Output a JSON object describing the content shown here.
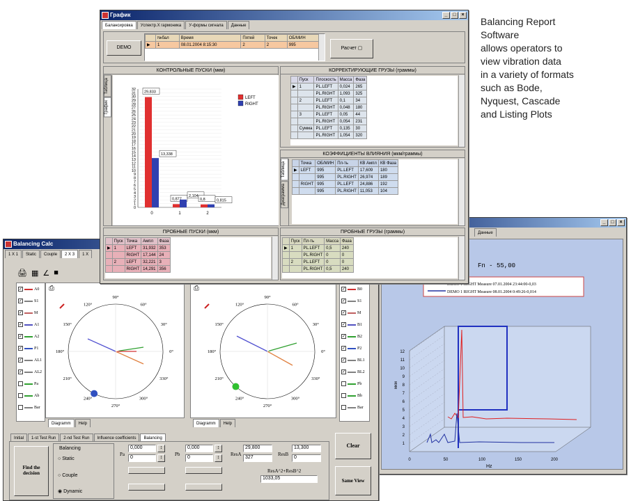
{
  "caption": {
    "line1": "Balancing Report",
    "line2": "Software",
    "line3": "allows operators to",
    "line4": "view vibration data",
    "line5": "in a variety of formats",
    "line6": "such as Bode,",
    "line7": "Nyquest, Cascade",
    "line8": "and Listing Plots"
  },
  "graph": {
    "title": "График",
    "menu": [
      "Балансировка",
      "Уcпектр.Х гармоника",
      "У-формы сигнала",
      "Данные"
    ],
    "demo": "DEMO",
    "table_headers": [
      "№бал",
      "Время",
      "Пятей",
      "Точек",
      "ОБ/МИН"
    ],
    "table_row": [
      "1",
      "08.01.2004 8:15:30",
      "2",
      "2",
      "995"
    ],
    "raschet": "Расчет",
    "kp_title": "КОНТРОЛЬНЫЕ ПУСКИ (мкм)",
    "vtab_table": "Таблица",
    "vtab_graph": "График",
    "legend_left": "LEFT",
    "legend_right": "RIGHT",
    "kg_title": "КОРРЕКТИРУЮЩИЕ ГРУЗЫ (граммы)",
    "kg_headers": [
      "Пуск",
      "Плоскость",
      "Масса",
      "Фаза"
    ],
    "kg_rows": [
      [
        "1",
        "PL.LEFT",
        "0,024",
        "265"
      ],
      [
        "",
        "PL.RIGHT",
        "1,093",
        "325"
      ],
      [
        "2",
        "PL.LEFT",
        "0,1",
        "34"
      ],
      [
        "",
        "PL.RIGHT",
        "0,048",
        "180"
      ],
      [
        "3",
        "PL.LEFT",
        "0,05",
        "44"
      ],
      [
        "",
        "PL.RIGHT",
        "0,054",
        "231"
      ],
      [
        "Сумма",
        "PL.LEFT",
        "0,135",
        "30"
      ],
      [
        "",
        "PL.RIGHT",
        "1,054",
        "320"
      ]
    ],
    "kv_title": "КОЭФФИЦИЕНТЫ ВЛИЯНИЯ (мкм/граммы)",
    "kv_headers": [
      "Точка",
      "ОБ/МИН",
      "Пл-ть",
      "КВ Ампл",
      "КВ Фаза"
    ],
    "kv_rows": [
      [
        "LEFT",
        "995",
        "PL.LEFT",
        "17,609",
        "180"
      ],
      [
        "",
        "995",
        "PL.RIGHT",
        "26,974",
        "189"
      ],
      [
        "RIGHT",
        "995",
        "PL.LEFT",
        "24,886",
        "192"
      ],
      [
        "",
        "995",
        "PL.RIGHT",
        "11,053",
        "104"
      ]
    ],
    "vtab_diag": "Диаграмма",
    "pp_title": "ПРОБНЫЕ ПУСКИ (мкм)",
    "pp_headers": [
      "Пуск",
      "Точка",
      "Ампл",
      "Фаза"
    ],
    "pp_rows": [
      [
        "1",
        "LEFT",
        "31,932",
        "353"
      ],
      [
        "",
        "RIGHT",
        "17,144",
        "24"
      ],
      [
        "2",
        "LEFT",
        "32,221",
        "3"
      ],
      [
        "",
        "RIGHT",
        "14,291",
        "356"
      ]
    ],
    "pg_title": "ПРОБНЫЕ ГРУЗЫ (граммы)",
    "pg_headers": [
      "Пуск",
      "Пл-ть",
      "Масса",
      "Фаза"
    ],
    "pg_rows": [
      [
        "1",
        "PL.LEFT",
        "0,5",
        "240"
      ],
      [
        "",
        "PL.RIGHT",
        "0",
        "0"
      ],
      [
        "2",
        "PL.LEFT",
        "0",
        "0"
      ],
      [
        "",
        "PL.RIGHT",
        "0,5",
        "240"
      ]
    ]
  },
  "chart_data": [
    {
      "type": "bar",
      "categories": [
        "0",
        "1",
        "2"
      ],
      "series": [
        {
          "name": "LEFT",
          "values": [
            29.833,
            0.877,
            0.8
          ]
        },
        {
          "name": "RIGHT",
          "values": [
            13.338,
            2.104,
            0.815
          ]
        }
      ],
      "data_labels": [
        [
          "29,833",
          "0,877",
          "0,8"
        ],
        [
          "13,338",
          "2,104",
          "0,815"
        ]
      ],
      "yticks": [
        "0",
        "1",
        "2",
        "3",
        "4",
        "5",
        "6",
        "7",
        "8",
        "9",
        "10",
        "11",
        "12",
        "13",
        "14",
        "15",
        "16",
        "17",
        "18",
        "19",
        "20",
        "21",
        "22",
        "23",
        "24",
        "25",
        "26",
        "27",
        "28",
        "29",
        "30",
        "31",
        "32"
      ],
      "ylim": [
        0,
        32
      ],
      "colors": [
        "#e03030",
        "#3040b0"
      ]
    },
    {
      "type": "line",
      "title": "Fn - 55,00",
      "xlabel": "Hz",
      "ylabel": "мкм",
      "xticks": [
        "0",
        "50",
        "100",
        "150",
        "200"
      ],
      "yticks": [
        "0",
        "1",
        "2",
        "3",
        "4",
        "5",
        "6",
        "7",
        "8",
        "9",
        "10",
        "11",
        "12"
      ],
      "legend": [
        "DEMO 1 RIGHT Measure 07.01.2004 23:44:00-0,03",
        "DEMO 1 RIGHT Measure 08.01.2004 0:49:26-0,014"
      ],
      "colors": [
        "#e02020",
        "#2030a0"
      ]
    }
  ],
  "cascade": {
    "menu": "Данные"
  },
  "calc": {
    "title": "Balancing Calc",
    "tabs": [
      "1 X 1",
      "Static",
      "Couple",
      "2 X 3",
      "1 X"
    ],
    "left_items": [
      "A0",
      "S1",
      "M",
      "A1",
      "A2",
      "P1",
      "AL1",
      "AL2",
      "Pa",
      "Ab",
      "Bar"
    ],
    "right_items": [
      "B0",
      "S1",
      "M",
      "B1",
      "B2",
      "P2",
      "BL1",
      "BL2",
      "Pb",
      "Bb",
      "Bar"
    ],
    "angles": [
      "90°",
      "60°",
      "120°",
      "30°",
      "150°",
      "0°",
      "180°",
      "330°",
      "210°",
      "300°",
      "240°",
      "270°"
    ],
    "diag_tab": "Diagramm",
    "help_tab": "Help",
    "bottom_tabs": [
      "Initial",
      "1-st Test Run",
      "2-nd Test Run",
      "Influence coefficients",
      "Balancing"
    ],
    "find": "Find the decision",
    "balancing": "Balancing",
    "radios": [
      "Static",
      "Couple",
      "Dynamic"
    ],
    "pa": "Pa",
    "pb": "Pb",
    "resa": "ResA",
    "resb": "ResB",
    "v1": "0,000",
    "v2": "0",
    "v3": "0,000",
    "v4": "0",
    "v5": "29,800",
    "v6": "327",
    "v7": "13,300",
    "v8": "0",
    "formula": "ResA^2+ResB^2",
    "formula_val": "1033,05",
    "clear": "Clear",
    "same": "Same View"
  }
}
